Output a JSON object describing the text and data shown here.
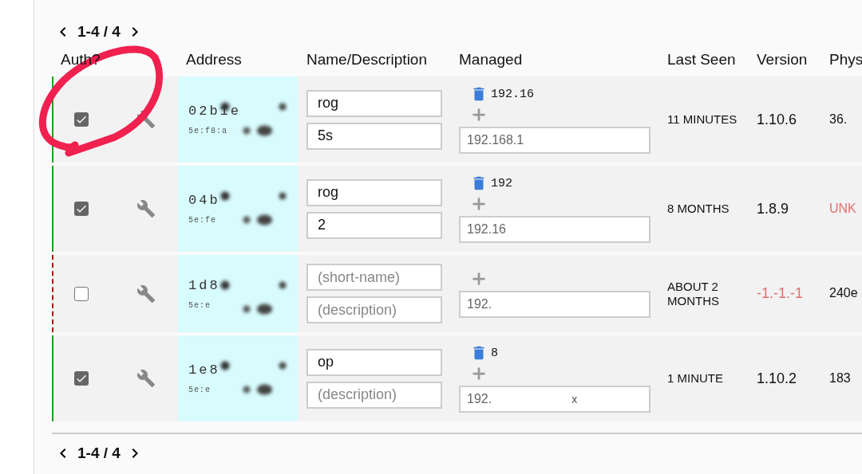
{
  "pagination_top": {
    "label": "1-4 / 4"
  },
  "columns": [
    "Auth?",
    "Address",
    "Name/Description",
    "Managed",
    "Last Seen",
    "Version",
    "Phys"
  ],
  "rows": [
    {
      "online": true,
      "authorized": true,
      "address": "02b1e",
      "mac": "5e:f8:a",
      "name": {
        "value": "rog"
      },
      "description": {
        "value": "5s"
      },
      "assigned_ips": [
        "192.16"
      ],
      "new_ip": {
        "value": "192.168.1"
      },
      "last_seen": "11 MINUTES",
      "version": {
        "text": "1.10.6",
        "error": false
      },
      "phys": {
        "text": "36.",
        "error": false
      }
    },
    {
      "online": true,
      "authorized": true,
      "address": "04b",
      "mac": "5e:fe",
      "name": {
        "value": "rog"
      },
      "description": {
        "value": "2"
      },
      "assigned_ips": [
        "192"
      ],
      "new_ip": {
        "value": "192.16"
      },
      "last_seen": "8 MONTHS",
      "version": {
        "text": "1.8.9",
        "error": false
      },
      "phys": {
        "text": "UNK",
        "error": true
      }
    },
    {
      "online": false,
      "authorized": false,
      "address": "1d8",
      "mac": "5e:e",
      "name": {
        "placeholder": "(short-name)"
      },
      "description": {
        "placeholder": "(description)"
      },
      "new_ip": {
        "value": "192."
      },
      "last_seen": "ABOUT 2 MONTHS",
      "version": {
        "text": "-1.-1.-1",
        "error": true
      },
      "phys": {
        "text": "240e",
        "error": false
      }
    },
    {
      "online": true,
      "authorized": true,
      "address": "1e8",
      "mac": "5e:e",
      "name": {
        "value": "op"
      },
      "description": {
        "placeholder": "(description)"
      },
      "assigned_ips": [
        "8"
      ],
      "new_ip": {
        "value": "192.",
        "fragment": "x"
      },
      "last_seen": "1 MINUTE",
      "version": {
        "text": "1.10.2",
        "error": false
      },
      "phys": {
        "text": "183",
        "error": false
      }
    }
  ],
  "pagination_bottom": {
    "label": "1-4 / 4"
  }
}
